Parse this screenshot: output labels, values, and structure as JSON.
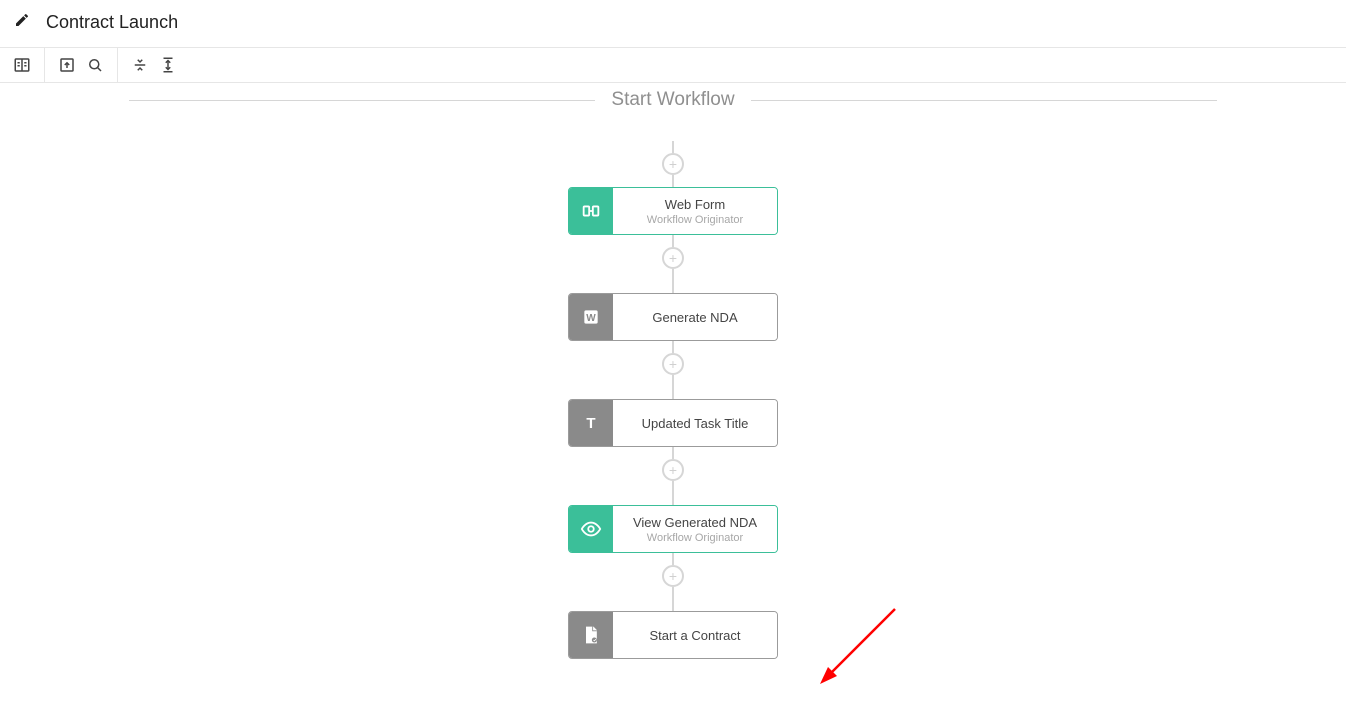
{
  "header": {
    "title": "Contract Launch"
  },
  "section": {
    "title": "Start Workflow"
  },
  "nodes": [
    {
      "title": "Web Form",
      "subtitle": "Workflow Originator"
    },
    {
      "title": "Generate NDA",
      "subtitle": ""
    },
    {
      "title": "Updated Task Title",
      "subtitle": ""
    },
    {
      "title": "View Generated NDA",
      "subtitle": "Workflow Originator"
    },
    {
      "title": "Start a Contract",
      "subtitle": ""
    }
  ],
  "colors": {
    "accent": "#3bbf99",
    "gray": "#8a8a8a",
    "annotation_red": "#ff0000"
  }
}
